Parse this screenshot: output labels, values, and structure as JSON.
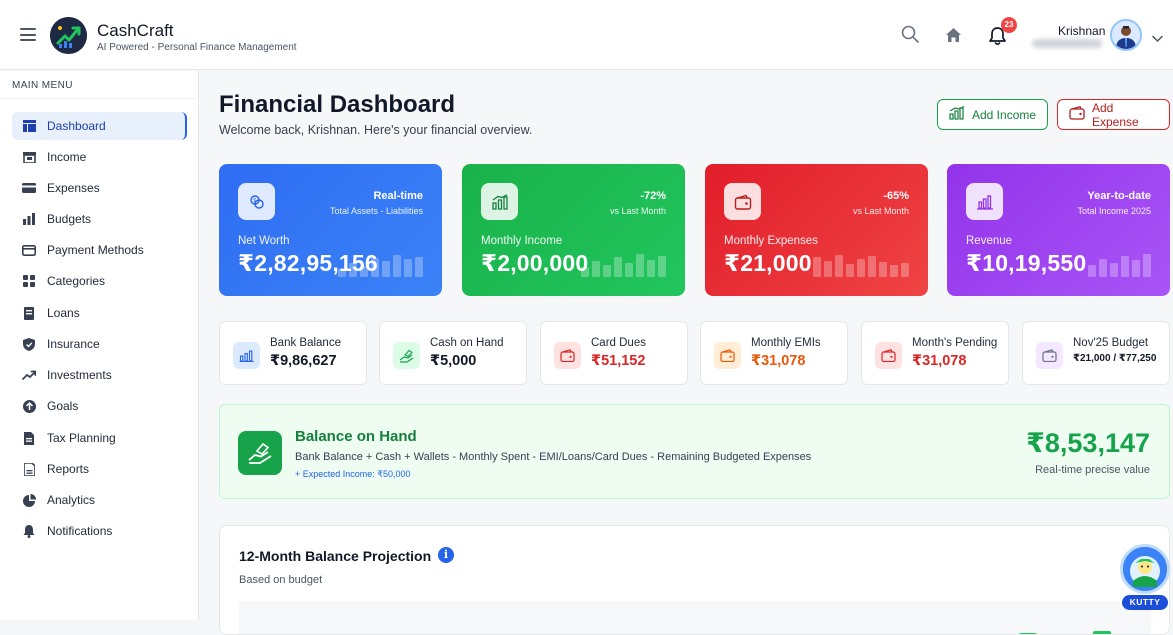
{
  "app": {
    "name": "CashCraft",
    "tagline": "AI Powered - Personal Finance Management"
  },
  "header": {
    "notification_count": "23",
    "user_name": "Krishnan"
  },
  "sidebar": {
    "title": "MAIN MENU",
    "items": [
      {
        "label": "Dashboard",
        "icon": "dashboard-icon",
        "active": true
      },
      {
        "label": "Income",
        "icon": "income-icon"
      },
      {
        "label": "Expenses",
        "icon": "card-icon"
      },
      {
        "label": "Budgets",
        "icon": "bar-chart-icon"
      },
      {
        "label": "Payment Methods",
        "icon": "payment-icon"
      },
      {
        "label": "Categories",
        "icon": "grid-icon"
      },
      {
        "label": "Loans",
        "icon": "document-icon"
      },
      {
        "label": "Insurance",
        "icon": "shield-icon"
      },
      {
        "label": "Investments",
        "icon": "trend-up-icon"
      },
      {
        "label": "Goals",
        "icon": "target-icon"
      },
      {
        "label": "Tax Planning",
        "icon": "file-icon"
      },
      {
        "label": "Reports",
        "icon": "folder-icon"
      },
      {
        "label": "Analytics",
        "icon": "pie-chart-icon"
      },
      {
        "label": "Notifications",
        "icon": "bell-icon"
      }
    ]
  },
  "page": {
    "title": "Financial Dashboard",
    "subtitle": "Welcome back, Krishnan. Here's your financial overview.",
    "add_income": "Add Income",
    "add_expense": "Add Expense"
  },
  "cards": {
    "net_worth": {
      "badge": "Real-time",
      "note": "Total Assets - Liabilities",
      "label": "Net Worth",
      "value": "₹2,82,95,156"
    },
    "monthly_income": {
      "badge": "-72%",
      "note": "vs Last Month",
      "label": "Monthly Income",
      "value": "₹2,00,000"
    },
    "monthly_expenses": {
      "badge": "-65%",
      "note": "vs Last Month",
      "label": "Monthly Expenses",
      "value": "₹21,000"
    },
    "revenue": {
      "badge": "Year-to-date",
      "note": "Total Income 2025",
      "label": "Revenue",
      "value": "₹10,19,550"
    }
  },
  "stats": [
    {
      "label": "Bank Balance",
      "value": "₹9,86,627",
      "color": "#111827"
    },
    {
      "label": "Cash on Hand",
      "value": "₹5,000",
      "color": "#111827"
    },
    {
      "label": "Card Dues",
      "value": "₹51,152",
      "color": "#dc2626"
    },
    {
      "label": "Monthly EMIs",
      "value": "₹31,078",
      "color": "#ea580c"
    },
    {
      "label": "Month's Pending",
      "value": "₹31,078",
      "color": "#dc2626"
    },
    {
      "label": "Nov'25 Budget",
      "value": "₹21,000 / ₹77,250",
      "color": "#111827"
    }
  ],
  "balance": {
    "title": "Balance on Hand",
    "formula": "Bank Balance + Cash + Wallets - Monthly Spent - EMI/Loans/Card Dues - Remaining Budgeted Expenses",
    "expected": "+ Expected Income: ₹50,000",
    "value": "₹8,53,147",
    "note": "Real-time precise value"
  },
  "projection": {
    "title": "12-Month Balance Projection",
    "info": "i",
    "subtitle": "Based on budget"
  },
  "assistant": {
    "label": "KUTTY"
  },
  "colors": {
    "primary": "#2563eb",
    "success": "#16a34a",
    "danger": "#dc2626",
    "purple": "#9333ea"
  }
}
